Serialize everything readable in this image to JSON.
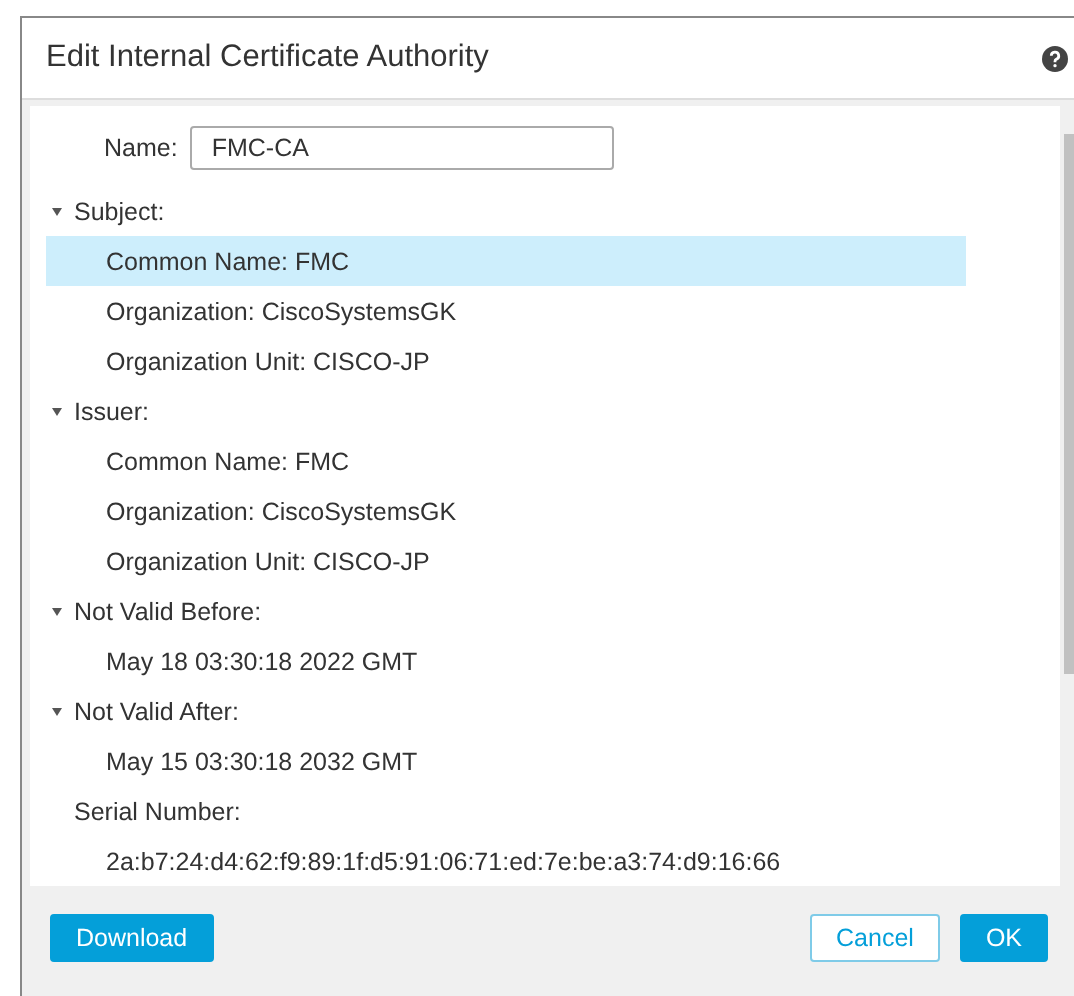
{
  "dialog": {
    "title": "Edit Internal Certificate Authority"
  },
  "name_field": {
    "label": "Name:",
    "value": "FMC-CA"
  },
  "sections": [
    {
      "title": "Subject:",
      "expanded": true,
      "rows": [
        {
          "text": "Common Name: FMC",
          "selected": true
        },
        {
          "text": "Organization: CiscoSystemsGK",
          "selected": false
        },
        {
          "text": "Organization Unit: CISCO-JP",
          "selected": false
        }
      ]
    },
    {
      "title": "Issuer:",
      "expanded": true,
      "rows": [
        {
          "text": "Common Name: FMC",
          "selected": false
        },
        {
          "text": "Organization: CiscoSystemsGK",
          "selected": false
        },
        {
          "text": "Organization Unit: CISCO-JP",
          "selected": false
        }
      ]
    },
    {
      "title": "Not Valid Before:",
      "expanded": true,
      "rows": [
        {
          "text": "May 18 03:30:18 2022 GMT",
          "selected": false
        }
      ]
    },
    {
      "title": "Not Valid After:",
      "expanded": true,
      "rows": [
        {
          "text": "May 15 03:30:18 2032 GMT",
          "selected": false
        }
      ]
    },
    {
      "title": "Serial Number:",
      "rows": [
        {
          "text": "2a:b7:24:d4:62:f9:89:1f:d5:91:06:71:ed:7e:be:a3:74:d9:16:66",
          "selected": false
        }
      ]
    }
  ],
  "buttons": [
    {
      "label": "Download",
      "kind": "primary"
    },
    {
      "label": "Cancel",
      "kind": "secondary"
    },
    {
      "label": "OK",
      "kind": "primary"
    }
  ]
}
